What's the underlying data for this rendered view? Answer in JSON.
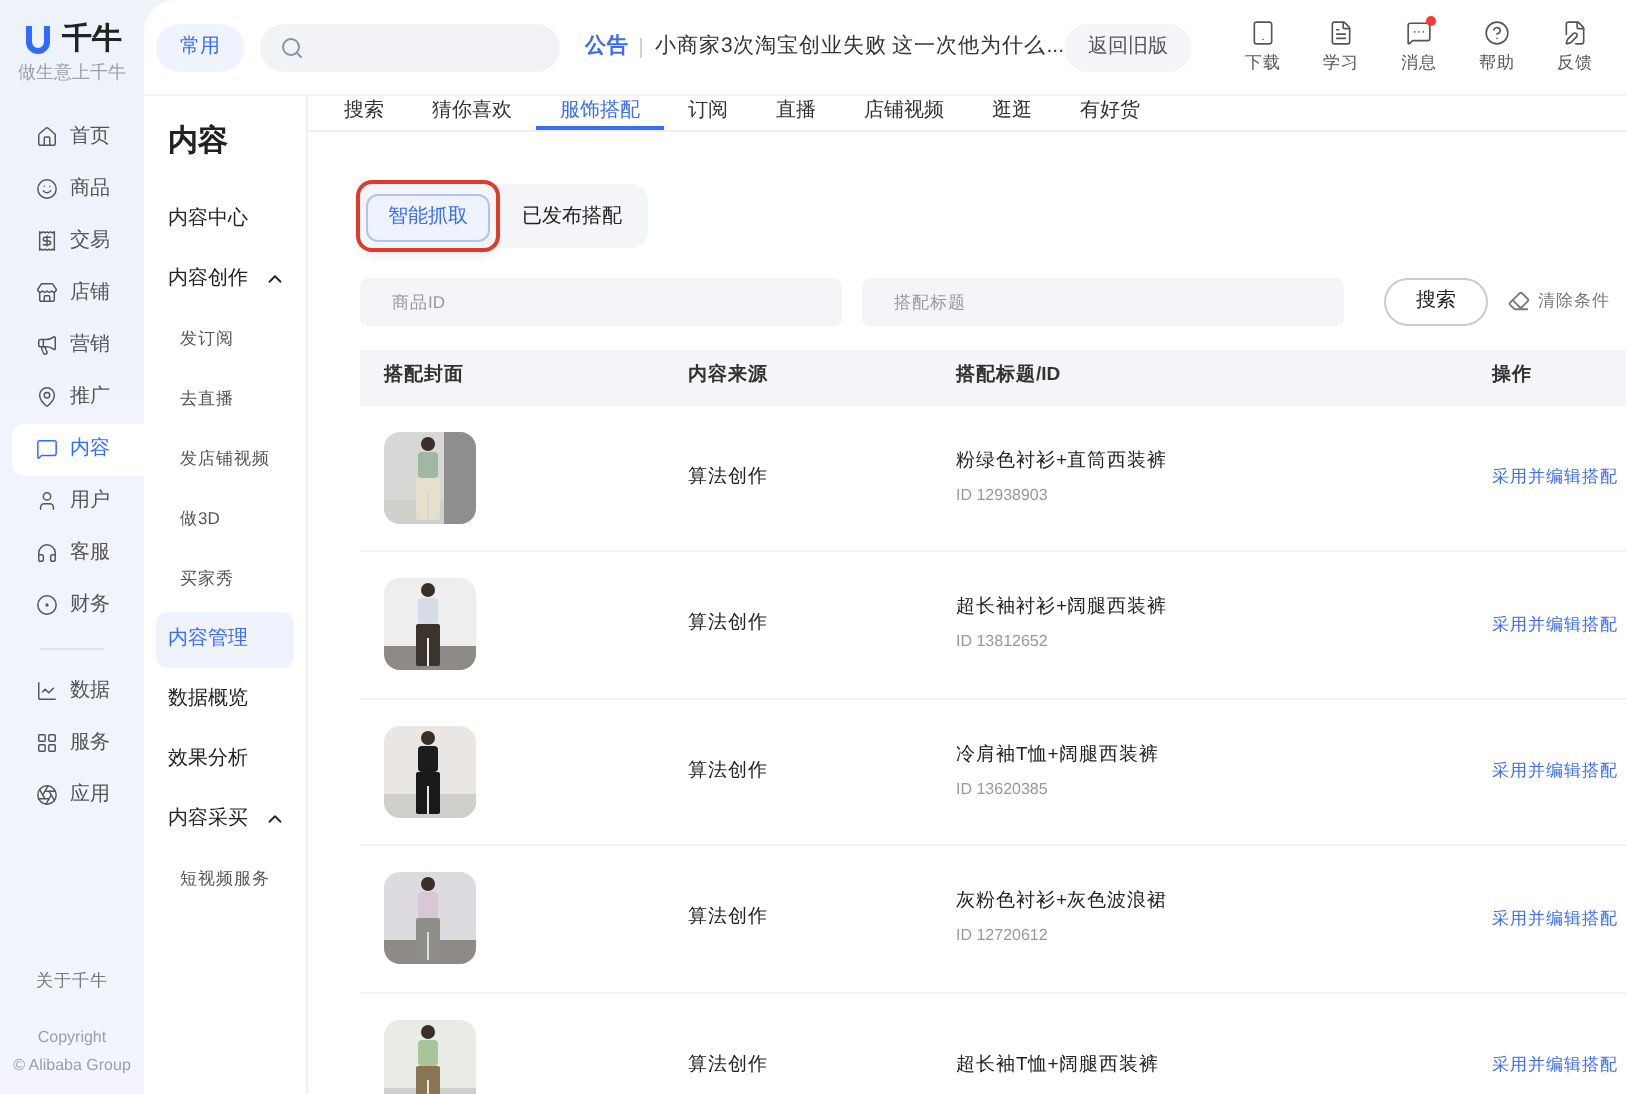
{
  "brand": {
    "name": "千牛",
    "slogan": "做生意上千牛"
  },
  "header": {
    "common_button": "常用",
    "announcement": {
      "label": "公告",
      "text": "小商家3次淘宝创业失败 这一次他为什么..."
    },
    "old_version_button": "返回旧版",
    "tools": [
      {
        "label": "下载",
        "kind": "download",
        "badge": false
      },
      {
        "label": "学习",
        "kind": "learn",
        "badge": false
      },
      {
        "label": "消息",
        "kind": "message",
        "badge": true
      },
      {
        "label": "帮助",
        "kind": "help",
        "badge": false
      },
      {
        "label": "反馈",
        "kind": "feedback",
        "badge": false
      }
    ]
  },
  "rail": {
    "groups": [
      [
        {
          "label": "首页",
          "kind": "home",
          "selected": false
        },
        {
          "label": "商品",
          "kind": "goods",
          "selected": false
        },
        {
          "label": "交易",
          "kind": "trade",
          "selected": false
        },
        {
          "label": "店铺",
          "kind": "store",
          "selected": false
        },
        {
          "label": "营销",
          "kind": "market",
          "selected": false
        },
        {
          "label": "推广",
          "kind": "promo",
          "selected": false
        },
        {
          "label": "内容",
          "kind": "content",
          "selected": true
        },
        {
          "label": "用户",
          "kind": "user",
          "selected": false
        },
        {
          "label": "客服",
          "kind": "service",
          "selected": false
        },
        {
          "label": "财务",
          "kind": "finance",
          "selected": false
        }
      ],
      [
        {
          "label": "数据",
          "kind": "data",
          "selected": false
        },
        {
          "label": "服务",
          "kind": "apps",
          "selected": false
        },
        {
          "label": "应用",
          "kind": "app",
          "selected": false
        }
      ]
    ],
    "about": "关于千牛",
    "copyright": "Copyright",
    "company": "© Alibaba Group"
  },
  "sidebar": {
    "title": "内容",
    "items": [
      {
        "label": "内容中心",
        "selected": false
      },
      {
        "label": "内容创作",
        "selected": false,
        "expanded": true,
        "children": [
          {
            "label": "发订阅",
            "selected": false
          },
          {
            "label": "去直播",
            "selected": false
          },
          {
            "label": "发店铺视频",
            "selected": false
          },
          {
            "label": "做3D",
            "selected": false
          },
          {
            "label": "买家秀",
            "selected": false
          }
        ]
      },
      {
        "label": "内容管理",
        "selected": true
      },
      {
        "label": "数据概览",
        "selected": false
      },
      {
        "label": "效果分析",
        "selected": false
      },
      {
        "label": "内容采买",
        "selected": false,
        "expanded": true,
        "children": [
          {
            "label": "短视频服务",
            "selected": false
          }
        ]
      }
    ]
  },
  "tabs": [
    {
      "label": "搜索",
      "selected": false
    },
    {
      "label": "猜你喜欢",
      "selected": false
    },
    {
      "label": "服饰搭配",
      "selected": true
    },
    {
      "label": "订阅",
      "selected": false
    },
    {
      "label": "直播",
      "selected": false
    },
    {
      "label": "店铺视频",
      "selected": false
    },
    {
      "label": "逛逛",
      "selected": false
    },
    {
      "label": "有好货",
      "selected": false
    }
  ],
  "segments": [
    {
      "label": "智能抓取",
      "selected": true,
      "highlighted": true
    },
    {
      "label": "已发布搭配",
      "selected": false,
      "highlighted": false
    }
  ],
  "filters": {
    "fields": [
      {
        "placeholder": "商品ID"
      },
      {
        "placeholder": "搭配标题"
      }
    ],
    "search_button": "搜索",
    "clear": "清除条件"
  },
  "table": {
    "columns": [
      "搭配封面",
      "内容来源",
      "搭配标题/ID",
      "操作"
    ],
    "rows": [
      {
        "source": "算法创作",
        "title": "粉绿色衬衫+直筒西装裤",
        "id": "ID 12938903",
        "action": "采用并编辑搭配"
      },
      {
        "source": "算法创作",
        "title": "超长袖衬衫+阔腿西装裤",
        "id": "ID 13812652",
        "action": "采用并编辑搭配"
      },
      {
        "source": "算法创作",
        "title": "冷肩袖T恤+阔腿西装裤",
        "id": "ID 13620385",
        "action": "采用并编辑搭配"
      },
      {
        "source": "算法创作",
        "title": "灰粉色衬衫+灰色波浪裙",
        "id": "ID 12720612",
        "action": "采用并编辑搭配"
      },
      {
        "source": "算法创作",
        "title": "超长袖T恤+阔腿西装裤",
        "action": "采用并编辑搭配"
      }
    ]
  }
}
